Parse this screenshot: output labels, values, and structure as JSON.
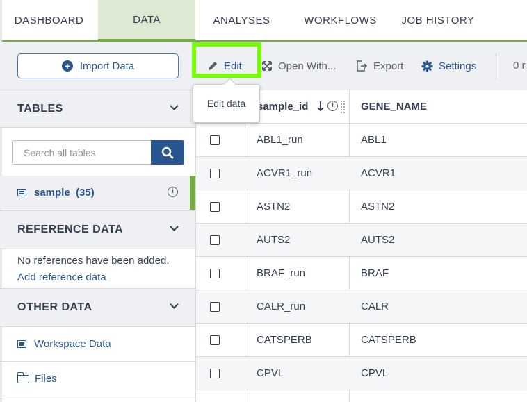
{
  "nav": {
    "tabs": [
      {
        "label": "DASHBOARD"
      },
      {
        "label": "DATA"
      },
      {
        "label": "ANALYSES"
      },
      {
        "label": "WORKFLOWS"
      },
      {
        "label": "JOB HISTORY"
      }
    ],
    "active_tab": "DATA"
  },
  "toolbar": {
    "import_label": "Import Data",
    "edit_label": "Edit",
    "open_with_label": "Open With...",
    "export_label": "Export",
    "settings_label": "Settings",
    "row_count_label": "0 r"
  },
  "tooltip": {
    "text": "Edit data"
  },
  "sidebar": {
    "tables_heading": "TABLES",
    "search_placeholder": "Search all tables",
    "table_item": "sample  (35)",
    "reference_heading": "REFERENCE DATA",
    "no_references": "No references have been added.",
    "add_reference": "Add reference data",
    "other_heading": "OTHER DATA",
    "workspace_data": "Workspace Data",
    "files": "Files"
  },
  "table": {
    "columns": [
      "sample_id",
      "GENE_NAME"
    ],
    "rows": [
      [
        "ABL1_run",
        "ABL1"
      ],
      [
        "ACVR1_run",
        "ACVR1"
      ],
      [
        "ASTN2",
        "ASTN2"
      ],
      [
        "AUTS2",
        "AUTS2"
      ],
      [
        "BRAF_run",
        "BRAF"
      ],
      [
        "CALR_run",
        "CALR"
      ],
      [
        "CATSPERB",
        "CATSPERB"
      ],
      [
        "CPVL",
        "CPVL"
      ]
    ]
  },
  "colors": {
    "accent_green": "#74ae43",
    "highlight_green": "#76ff03",
    "brand_blue": "#2a568f"
  }
}
